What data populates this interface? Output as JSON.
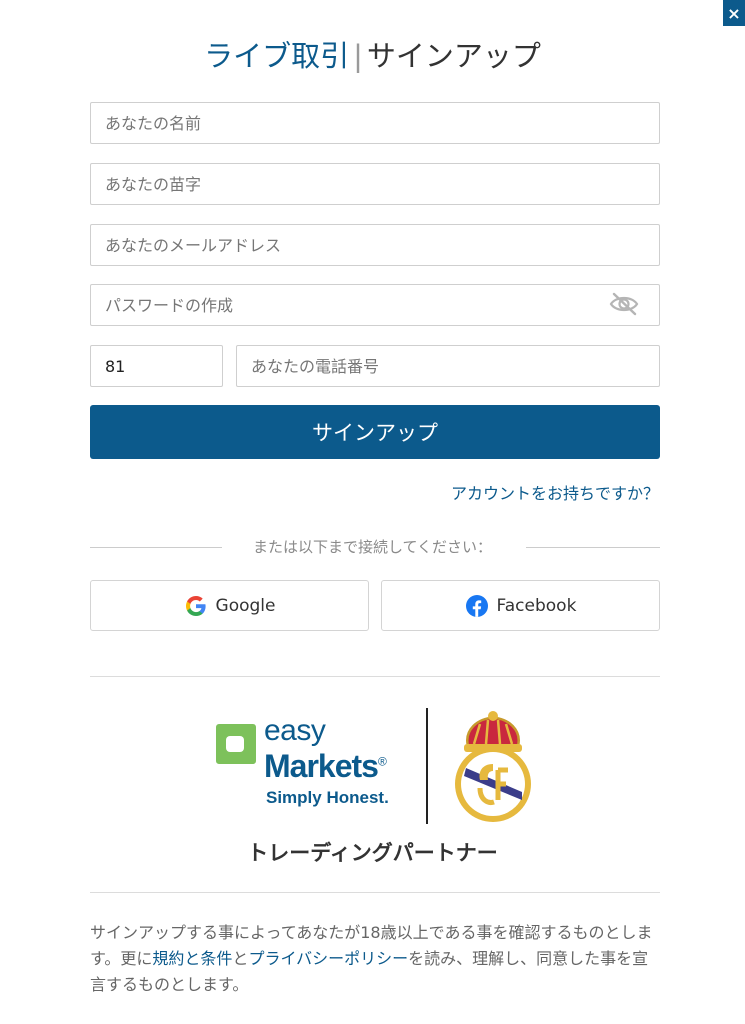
{
  "header": {
    "title_live": "ライブ取引",
    "title_sep": "|",
    "title_signup": "サインアップ",
    "close_label": "×"
  },
  "form": {
    "first_name_placeholder": "あなたの名前",
    "last_name_placeholder": "あなたの苗字",
    "email_placeholder": "あなたのメールアドレス",
    "password_placeholder": "パスワードの作成",
    "country_code_value": "81",
    "phone_placeholder": "あなたの電話番号",
    "submit_label": "サインアップ",
    "login_link": "アカウントをお持ちですか？"
  },
  "social": {
    "divider_text": "または以下まで接続してください：",
    "google_label": "Google",
    "facebook_label": "Facebook"
  },
  "brand": {
    "easy": "easy",
    "markets": "Markets",
    "reg_mark": "®",
    "tagline": "Simply Honest.",
    "partner_text": "トレーディングパートナー",
    "brand_color": "#0c5a8c",
    "accent_color": "#7dc15b"
  },
  "legal": {
    "text_1": "サインアップする事によってあなたが18歳以上である事を確認するものとします。更に",
    "terms_link": "規約と条件",
    "text_2": "と",
    "privacy_link": "プライバシーポリシー",
    "text_3": "を読み、理解し、同意した事を宣言するものとします。"
  }
}
